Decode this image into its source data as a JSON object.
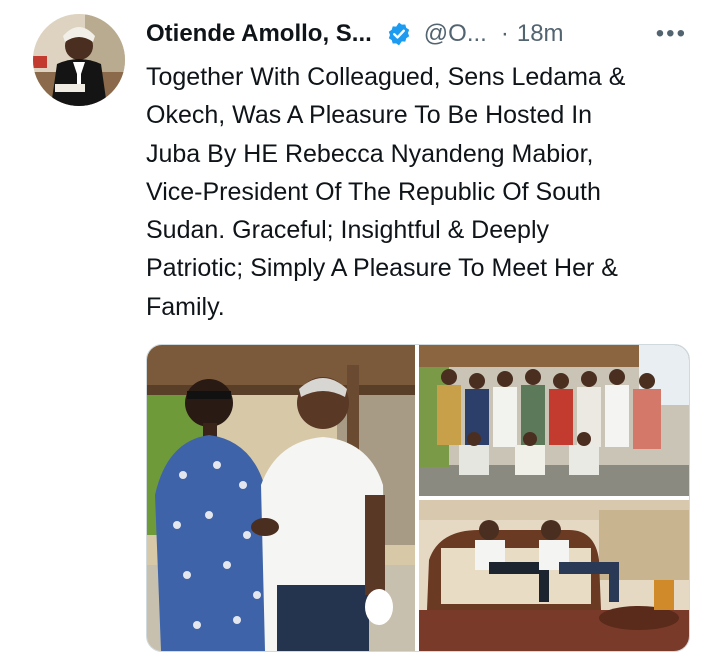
{
  "tweet": {
    "author": {
      "name": "Otiende Amollo, S...",
      "handle": "@O...",
      "verified": true
    },
    "separator": "·",
    "time": "18m",
    "more_icon": "more-horizontal-icon",
    "text": "Together With Colleagued, Sens Ledama &\nOkech, Was A Pleasure To Be Hosted In\nJuba By HE Rebecca Nyandeng Mabior,\nVice-President Of The Republic Of South\nSudan. Graceful; Insightful & Deeply\nPatriotic; Simply A Pleasure To Meet Her &\nFamily.",
    "media": {
      "count": 3,
      "photos": [
        "two-people-shaking-hands",
        "group-photo-outdoors",
        "men-seated-on-sofa"
      ]
    }
  },
  "colors": {
    "text": "#0f1419",
    "secondary": "#536471",
    "verified": "#1d9bf0",
    "border": "#cfd9de"
  }
}
